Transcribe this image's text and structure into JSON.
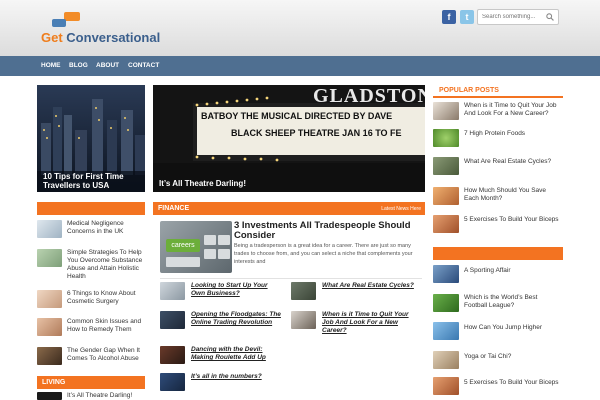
{
  "header": {
    "logo": {
      "part1": "Get",
      "part2": "Conversational"
    },
    "social": [
      {
        "name": "facebook",
        "glyph": "f"
      },
      {
        "name": "twitter",
        "glyph": "t"
      }
    ],
    "search_placeholder": "Search something..."
  },
  "nav": {
    "items": [
      "HOME",
      "BLOG",
      "ABOUT",
      "CONTACT"
    ]
  },
  "hero": {
    "left_caption": "10 Tips for First Time Travellers to USA",
    "right_caption": "It’s All Theatre Darling!",
    "marquee_sign": "GLADSTONE",
    "marquee_line1": "BATBOY THE MUSICAL DIRECTED BY DAVE",
    "marquee_line2": "BLACK SHEEP THEATRE JAN 16 TO FE"
  },
  "left_column": {
    "items": [
      "Medical Negligence Concerns in the UK",
      "Simple Strategies To Help You Overcome Substance Abuse and Attain Holistic Health",
      "6 Things to Know About Cosmetic Surgery",
      "Common Skin Issues and How to Remedy Them",
      "The Gender Gap When It Comes To Alcohol Abuse"
    ],
    "living_header": "LIVING",
    "living_first": "It’s All Theatre Darling!"
  },
  "finance": {
    "header": "FINANCE",
    "more": "Latest News Here",
    "featured_title": "3 Investments All Tradespeople Should Consider",
    "featured_excerpt": "Being a tradesperson is a great idea for a career. There are just so many trades to choose from, and you can select a niche that complements your interests and",
    "featured_image_label": "careers",
    "left_items": [
      "Looking to Start Up Your Own Business?",
      "Opening the Floodgates: The Online Trading Revolution",
      "Dancing with the Devil: Making Roulette Add Up",
      "It’s all in the numbers?"
    ],
    "right_items": [
      "What Are Real Estate Cycles?",
      "When is it Time to Quit Your Job And Look For a New Career?"
    ]
  },
  "sidebar": {
    "popular_header": "POPULAR POSTS",
    "popular": [
      "When is it Time to Quit Your Job And Look For a New Career?",
      "7 High Protein Foods",
      "What Are Real Estate Cycles?",
      "How Much Should You Save Each Month?",
      "5 Exercises To Build Your Biceps"
    ],
    "second": [
      "A Sporting Affair",
      "Which is the World’s Best Football League?",
      "How Can You Jump Higher",
      "Yoga or Tai Chi?",
      "5 Exercises To Build Your Biceps"
    ]
  },
  "colors": {
    "accent": "#f37321",
    "nav": "#4f6f91",
    "logo_orange": "#ef7d1c",
    "logo_blue": "#3b5f8c"
  }
}
